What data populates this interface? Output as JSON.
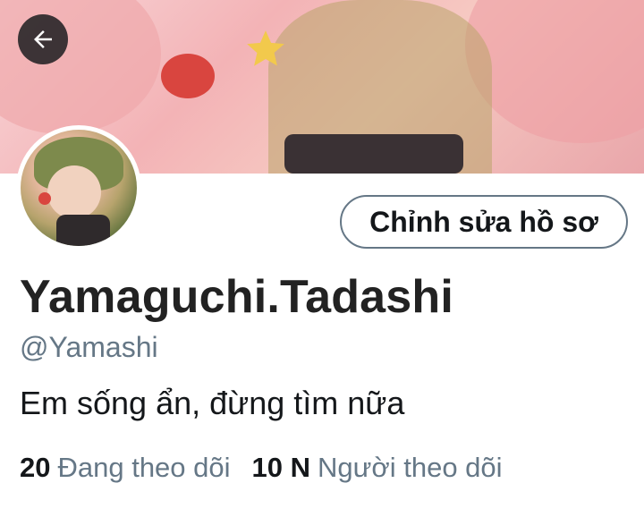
{
  "header": {
    "back_icon": "arrow-left-icon",
    "banner_colors": [
      "#f8d6d8",
      "#f3b3b6",
      "#e9a6aa",
      "#d9453f",
      "#f2c94c"
    ]
  },
  "profile": {
    "edit_button_label": "Chỉnh sửa hồ sơ",
    "display_name": "Yamaguchi.Tadashi",
    "handle": "@Yamashi",
    "bio": "Em sống ẩn, đừng tìm nữa",
    "following_count": "20",
    "following_label": "Đang theo dõi",
    "followers_count": "10 N",
    "followers_label": "Người theo dõi"
  },
  "colors": {
    "text_primary": "#14171a",
    "text_secondary": "#657786",
    "button_border": "#657786"
  }
}
